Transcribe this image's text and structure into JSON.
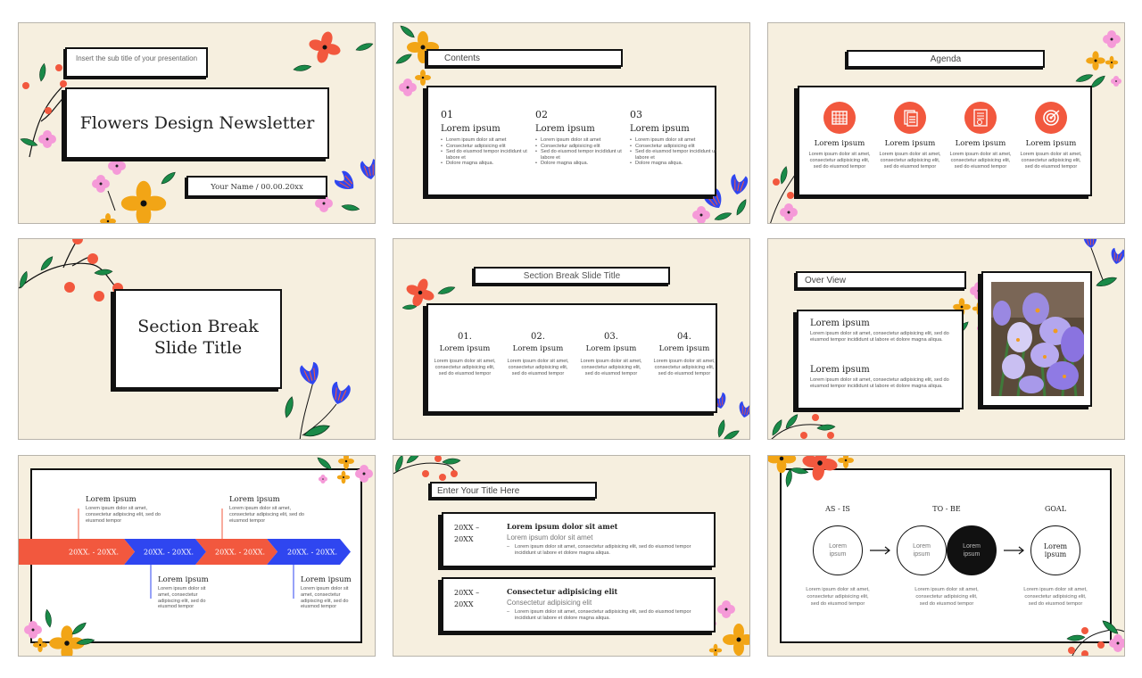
{
  "gallery": {
    "slides": [
      {
        "id": "title",
        "subtitle": "Insert the sub title of your presentation",
        "title": "Flowers Design Newsletter",
        "byline": "Your Name  /  00.00.20xx"
      },
      {
        "id": "contents",
        "heading": "Contents",
        "columns": [
          {
            "number": "01",
            "title": "Lorem ipsum",
            "bullets": [
              "Lorem ipsum dolor sit amet",
              "Consectetur adipisicing elit",
              "Sed do eiusmod tempor incididunt ut labore et",
              "Dolore magna aliqua."
            ]
          },
          {
            "number": "02",
            "title": "Lorem ipsum",
            "bullets": [
              "Lorem ipsum dolor sit amet",
              "Consectetur adipisicing elit",
              "Sed do eiusmod tempor incididunt ut labore et",
              "Dolore magna aliqua."
            ]
          },
          {
            "number": "03",
            "title": "Lorem ipsum",
            "bullets": [
              "Lorem ipsum dolor sit amet",
              "Consectetur adipisicing elit",
              "Sed do eiusmod tempor incididunt ut labore et",
              "Dolore magna aliqua."
            ]
          }
        ]
      },
      {
        "id": "agenda",
        "heading": "Agenda",
        "accent": "#f2583e",
        "items": [
          {
            "icon": "calendar-icon",
            "title": "Lorem ipsum",
            "text": "Lorem ipsum dolor sit amet, consectetur adipisicing elit, sed do eiusmod tempor"
          },
          {
            "icon": "document-icon",
            "title": "Lorem ipsum",
            "text": "Lorem ipsum dolor sit amet, consectetur adipisicing elit, sed do eiusmod tempor"
          },
          {
            "icon": "checklist-icon",
            "title": "Lorem ipsum",
            "text": "Lorem ipsum dolor sit amet, consectetur adipisicing elit, sed do eiusmod tempor"
          },
          {
            "icon": "target-icon",
            "title": "Lorem ipsum",
            "text": "Lorem ipsum dolor sit amet, consectetur adipisicing elit, sed do eiusmod tempor"
          }
        ]
      },
      {
        "id": "section-break",
        "title_line1": "Section Break",
        "title_line2": "Slide Title"
      },
      {
        "id": "section-four",
        "heading": "Section Break Slide Title",
        "columns": [
          {
            "number": "01.",
            "title": "Lorem ipsum",
            "text": "Lorem ipsum dolor sit amet, consectetur adipisicing elit, sed do eiusmod tempor"
          },
          {
            "number": "02.",
            "title": "Lorem ipsum",
            "text": "Lorem ipsum dolor sit amet, consectetur adipisicing elit, sed do eiusmod tempor"
          },
          {
            "number": "03.",
            "title": "Lorem ipsum",
            "text": "Lorem ipsum dolor sit amet, consectetur adipisicing elit, sed do eiusmod tempor"
          },
          {
            "number": "04.",
            "title": "Lorem ipsum",
            "text": "Lorem ipsum dolor sit amet, consectetur adipisicing elit, sed do eiusmod tempor"
          }
        ]
      },
      {
        "id": "overview",
        "heading": "Over View",
        "sections": [
          {
            "title": "Lorem ipsum",
            "text": "Lorem ipsum dolor sit amet, consectetur adipisicing elit, sed do eiusmod tempor incididunt ut labore et dolore magna aliqua."
          },
          {
            "title": "Lorem ipsum",
            "text": "Lorem ipsum dolor sit amet, consectetur adipisicing elit, sed do eiusmod tempor incididunt ut labore et dolore magna aliqua."
          }
        ],
        "photo": "purple-crocus-photo"
      },
      {
        "id": "timeline",
        "colors": {
          "red": "#f2583e",
          "blue": "#2f46f0"
        },
        "arrows": [
          "20XX. - 20XX.",
          "20XX. - 20XX.",
          "20XX. - 20XX.",
          "20XX. - 20XX."
        ],
        "top_items": [
          {
            "title": "Lorem ipsum",
            "text": "Lorem ipsum dolor sit amet, consectetur adipiscing elit, sed do eiusmod tempor"
          },
          {
            "title": "Lorem ipsum",
            "text": "Lorem ipsum dolor sit amet, consectetur adipiscing elit, sed do eiusmod tempor"
          }
        ],
        "bottom_items": [
          {
            "title": "Lorem ipsum",
            "text": "Lorem ipsum dolor sit amet, consectetur adipiscing elit, sed do eiusmod tempor"
          },
          {
            "title": "Lorem ipsum",
            "text": "Lorem ipsum dolor sit amet, consectetur adipiscing elit, sed do eiusmod tempor"
          }
        ]
      },
      {
        "id": "dated-list",
        "heading": "Enter Your Title Here",
        "entries": [
          {
            "date_line1": "20XX –",
            "date_line2": "20XX",
            "title": "Lorem ipsum dolor sit amet",
            "subtitle": "Lorem ipsum dolor sit amet",
            "text": "Lorem ipsum dolor sit amet, consectetur adipisicing elit, sed do eiusmod tempor incididunt ut labore et dolore magna aliqua."
          },
          {
            "date_line1": "20XX –",
            "date_line2": "20XX",
            "title": "Consectetur adipisicing elit",
            "subtitle": "Consectetur adipisicing elit",
            "text": "Lorem ipsum dolor sit amet, consectetur adipisicing elit, sed do eiusmod tempor incididunt ut labore et dolore magna aliqua."
          }
        ]
      },
      {
        "id": "as-is-to-be",
        "stages": [
          {
            "label": "AS - IS",
            "circle": "Lorem ipsum",
            "text": "Lorem ipsum dolor sit amet, consectetur adipisicing elit, sed do eiusmod tempor"
          },
          {
            "label": "TO - BE",
            "circle": "Lorem ipsum",
            "circle2": "Lorem ipsum",
            "text": "Lorem ipsum dolor sit amet, consectetur adipisicing elit, sed do eiusmod tempor"
          },
          {
            "label": "GOAL",
            "circle": "Lorem ipsum",
            "text": "Lorem ipsum dolor sit amet, consectetur adipisicing elit, sed do eiusmod tempor"
          }
        ]
      }
    ]
  }
}
